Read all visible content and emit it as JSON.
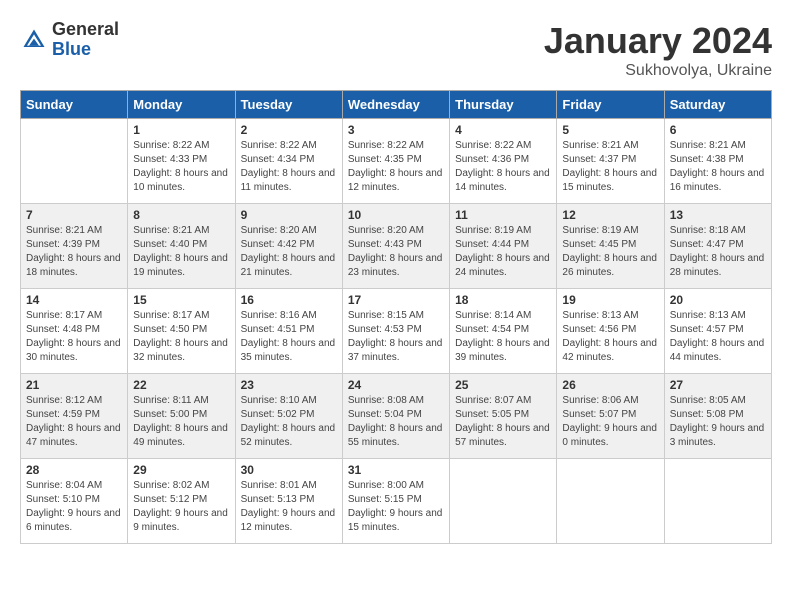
{
  "logo": {
    "general": "General",
    "blue": "Blue"
  },
  "title": "January 2024",
  "location": "Sukhovolya, Ukraine",
  "weekdays": [
    "Sunday",
    "Monday",
    "Tuesday",
    "Wednesday",
    "Thursday",
    "Friday",
    "Saturday"
  ],
  "rows": [
    [
      {
        "day": "",
        "sunrise": "",
        "sunset": "",
        "daylight": ""
      },
      {
        "day": "1",
        "sunrise": "Sunrise: 8:22 AM",
        "sunset": "Sunset: 4:33 PM",
        "daylight": "Daylight: 8 hours and 10 minutes."
      },
      {
        "day": "2",
        "sunrise": "Sunrise: 8:22 AM",
        "sunset": "Sunset: 4:34 PM",
        "daylight": "Daylight: 8 hours and 11 minutes."
      },
      {
        "day": "3",
        "sunrise": "Sunrise: 8:22 AM",
        "sunset": "Sunset: 4:35 PM",
        "daylight": "Daylight: 8 hours and 12 minutes."
      },
      {
        "day": "4",
        "sunrise": "Sunrise: 8:22 AM",
        "sunset": "Sunset: 4:36 PM",
        "daylight": "Daylight: 8 hours and 14 minutes."
      },
      {
        "day": "5",
        "sunrise": "Sunrise: 8:21 AM",
        "sunset": "Sunset: 4:37 PM",
        "daylight": "Daylight: 8 hours and 15 minutes."
      },
      {
        "day": "6",
        "sunrise": "Sunrise: 8:21 AM",
        "sunset": "Sunset: 4:38 PM",
        "daylight": "Daylight: 8 hours and 16 minutes."
      }
    ],
    [
      {
        "day": "7",
        "sunrise": "Sunrise: 8:21 AM",
        "sunset": "Sunset: 4:39 PM",
        "daylight": "Daylight: 8 hours and 18 minutes."
      },
      {
        "day": "8",
        "sunrise": "Sunrise: 8:21 AM",
        "sunset": "Sunset: 4:40 PM",
        "daylight": "Daylight: 8 hours and 19 minutes."
      },
      {
        "day": "9",
        "sunrise": "Sunrise: 8:20 AM",
        "sunset": "Sunset: 4:42 PM",
        "daylight": "Daylight: 8 hours and 21 minutes."
      },
      {
        "day": "10",
        "sunrise": "Sunrise: 8:20 AM",
        "sunset": "Sunset: 4:43 PM",
        "daylight": "Daylight: 8 hours and 23 minutes."
      },
      {
        "day": "11",
        "sunrise": "Sunrise: 8:19 AM",
        "sunset": "Sunset: 4:44 PM",
        "daylight": "Daylight: 8 hours and 24 minutes."
      },
      {
        "day": "12",
        "sunrise": "Sunrise: 8:19 AM",
        "sunset": "Sunset: 4:45 PM",
        "daylight": "Daylight: 8 hours and 26 minutes."
      },
      {
        "day": "13",
        "sunrise": "Sunrise: 8:18 AM",
        "sunset": "Sunset: 4:47 PM",
        "daylight": "Daylight: 8 hours and 28 minutes."
      }
    ],
    [
      {
        "day": "14",
        "sunrise": "Sunrise: 8:17 AM",
        "sunset": "Sunset: 4:48 PM",
        "daylight": "Daylight: 8 hours and 30 minutes."
      },
      {
        "day": "15",
        "sunrise": "Sunrise: 8:17 AM",
        "sunset": "Sunset: 4:50 PM",
        "daylight": "Daylight: 8 hours and 32 minutes."
      },
      {
        "day": "16",
        "sunrise": "Sunrise: 8:16 AM",
        "sunset": "Sunset: 4:51 PM",
        "daylight": "Daylight: 8 hours and 35 minutes."
      },
      {
        "day": "17",
        "sunrise": "Sunrise: 8:15 AM",
        "sunset": "Sunset: 4:53 PM",
        "daylight": "Daylight: 8 hours and 37 minutes."
      },
      {
        "day": "18",
        "sunrise": "Sunrise: 8:14 AM",
        "sunset": "Sunset: 4:54 PM",
        "daylight": "Daylight: 8 hours and 39 minutes."
      },
      {
        "day": "19",
        "sunrise": "Sunrise: 8:13 AM",
        "sunset": "Sunset: 4:56 PM",
        "daylight": "Daylight: 8 hours and 42 minutes."
      },
      {
        "day": "20",
        "sunrise": "Sunrise: 8:13 AM",
        "sunset": "Sunset: 4:57 PM",
        "daylight": "Daylight: 8 hours and 44 minutes."
      }
    ],
    [
      {
        "day": "21",
        "sunrise": "Sunrise: 8:12 AM",
        "sunset": "Sunset: 4:59 PM",
        "daylight": "Daylight: 8 hours and 47 minutes."
      },
      {
        "day": "22",
        "sunrise": "Sunrise: 8:11 AM",
        "sunset": "Sunset: 5:00 PM",
        "daylight": "Daylight: 8 hours and 49 minutes."
      },
      {
        "day": "23",
        "sunrise": "Sunrise: 8:10 AM",
        "sunset": "Sunset: 5:02 PM",
        "daylight": "Daylight: 8 hours and 52 minutes."
      },
      {
        "day": "24",
        "sunrise": "Sunrise: 8:08 AM",
        "sunset": "Sunset: 5:04 PM",
        "daylight": "Daylight: 8 hours and 55 minutes."
      },
      {
        "day": "25",
        "sunrise": "Sunrise: 8:07 AM",
        "sunset": "Sunset: 5:05 PM",
        "daylight": "Daylight: 8 hours and 57 minutes."
      },
      {
        "day": "26",
        "sunrise": "Sunrise: 8:06 AM",
        "sunset": "Sunset: 5:07 PM",
        "daylight": "Daylight: 9 hours and 0 minutes."
      },
      {
        "day": "27",
        "sunrise": "Sunrise: 8:05 AM",
        "sunset": "Sunset: 5:08 PM",
        "daylight": "Daylight: 9 hours and 3 minutes."
      }
    ],
    [
      {
        "day": "28",
        "sunrise": "Sunrise: 8:04 AM",
        "sunset": "Sunset: 5:10 PM",
        "daylight": "Daylight: 9 hours and 6 minutes."
      },
      {
        "day": "29",
        "sunrise": "Sunrise: 8:02 AM",
        "sunset": "Sunset: 5:12 PM",
        "daylight": "Daylight: 9 hours and 9 minutes."
      },
      {
        "day": "30",
        "sunrise": "Sunrise: 8:01 AM",
        "sunset": "Sunset: 5:13 PM",
        "daylight": "Daylight: 9 hours and 12 minutes."
      },
      {
        "day": "31",
        "sunrise": "Sunrise: 8:00 AM",
        "sunset": "Sunset: 5:15 PM",
        "daylight": "Daylight: 9 hours and 15 minutes."
      },
      {
        "day": "",
        "sunrise": "",
        "sunset": "",
        "daylight": ""
      },
      {
        "day": "",
        "sunrise": "",
        "sunset": "",
        "daylight": ""
      },
      {
        "day": "",
        "sunrise": "",
        "sunset": "",
        "daylight": ""
      }
    ]
  ]
}
